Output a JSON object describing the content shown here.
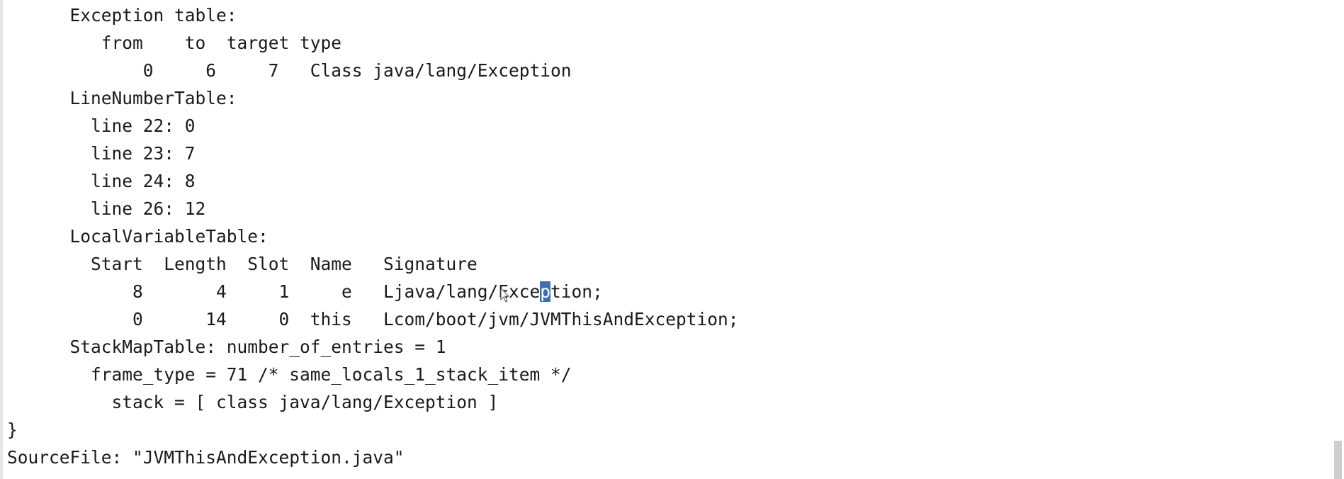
{
  "lines": [
    "      Exception table:",
    "         from    to  target type",
    "             0     6     7   Class java/lang/Exception",
    "      LineNumberTable:",
    "        line 22: 0",
    "        line 23: 7",
    "        line 24: 8",
    "        line 26: 12",
    "      LocalVariableTable:",
    "        Start  Length  Slot  Name   Signature",
    null,
    "            0      14     0  this   Lcom/boot/jvm/JVMThisAndException;",
    "      StackMapTable: number_of_entries = 1",
    "        frame_type = 71 /* same_locals_1_stack_item */",
    "          stack = [ class java/lang/Exception ]",
    "}",
    "SourceFile: \"JVMThisAndException.java\""
  ],
  "selected_line": {
    "before": "            8       4     1     e   Ljava/lang/Exce",
    "selected": "p",
    "after": "tion;"
  }
}
